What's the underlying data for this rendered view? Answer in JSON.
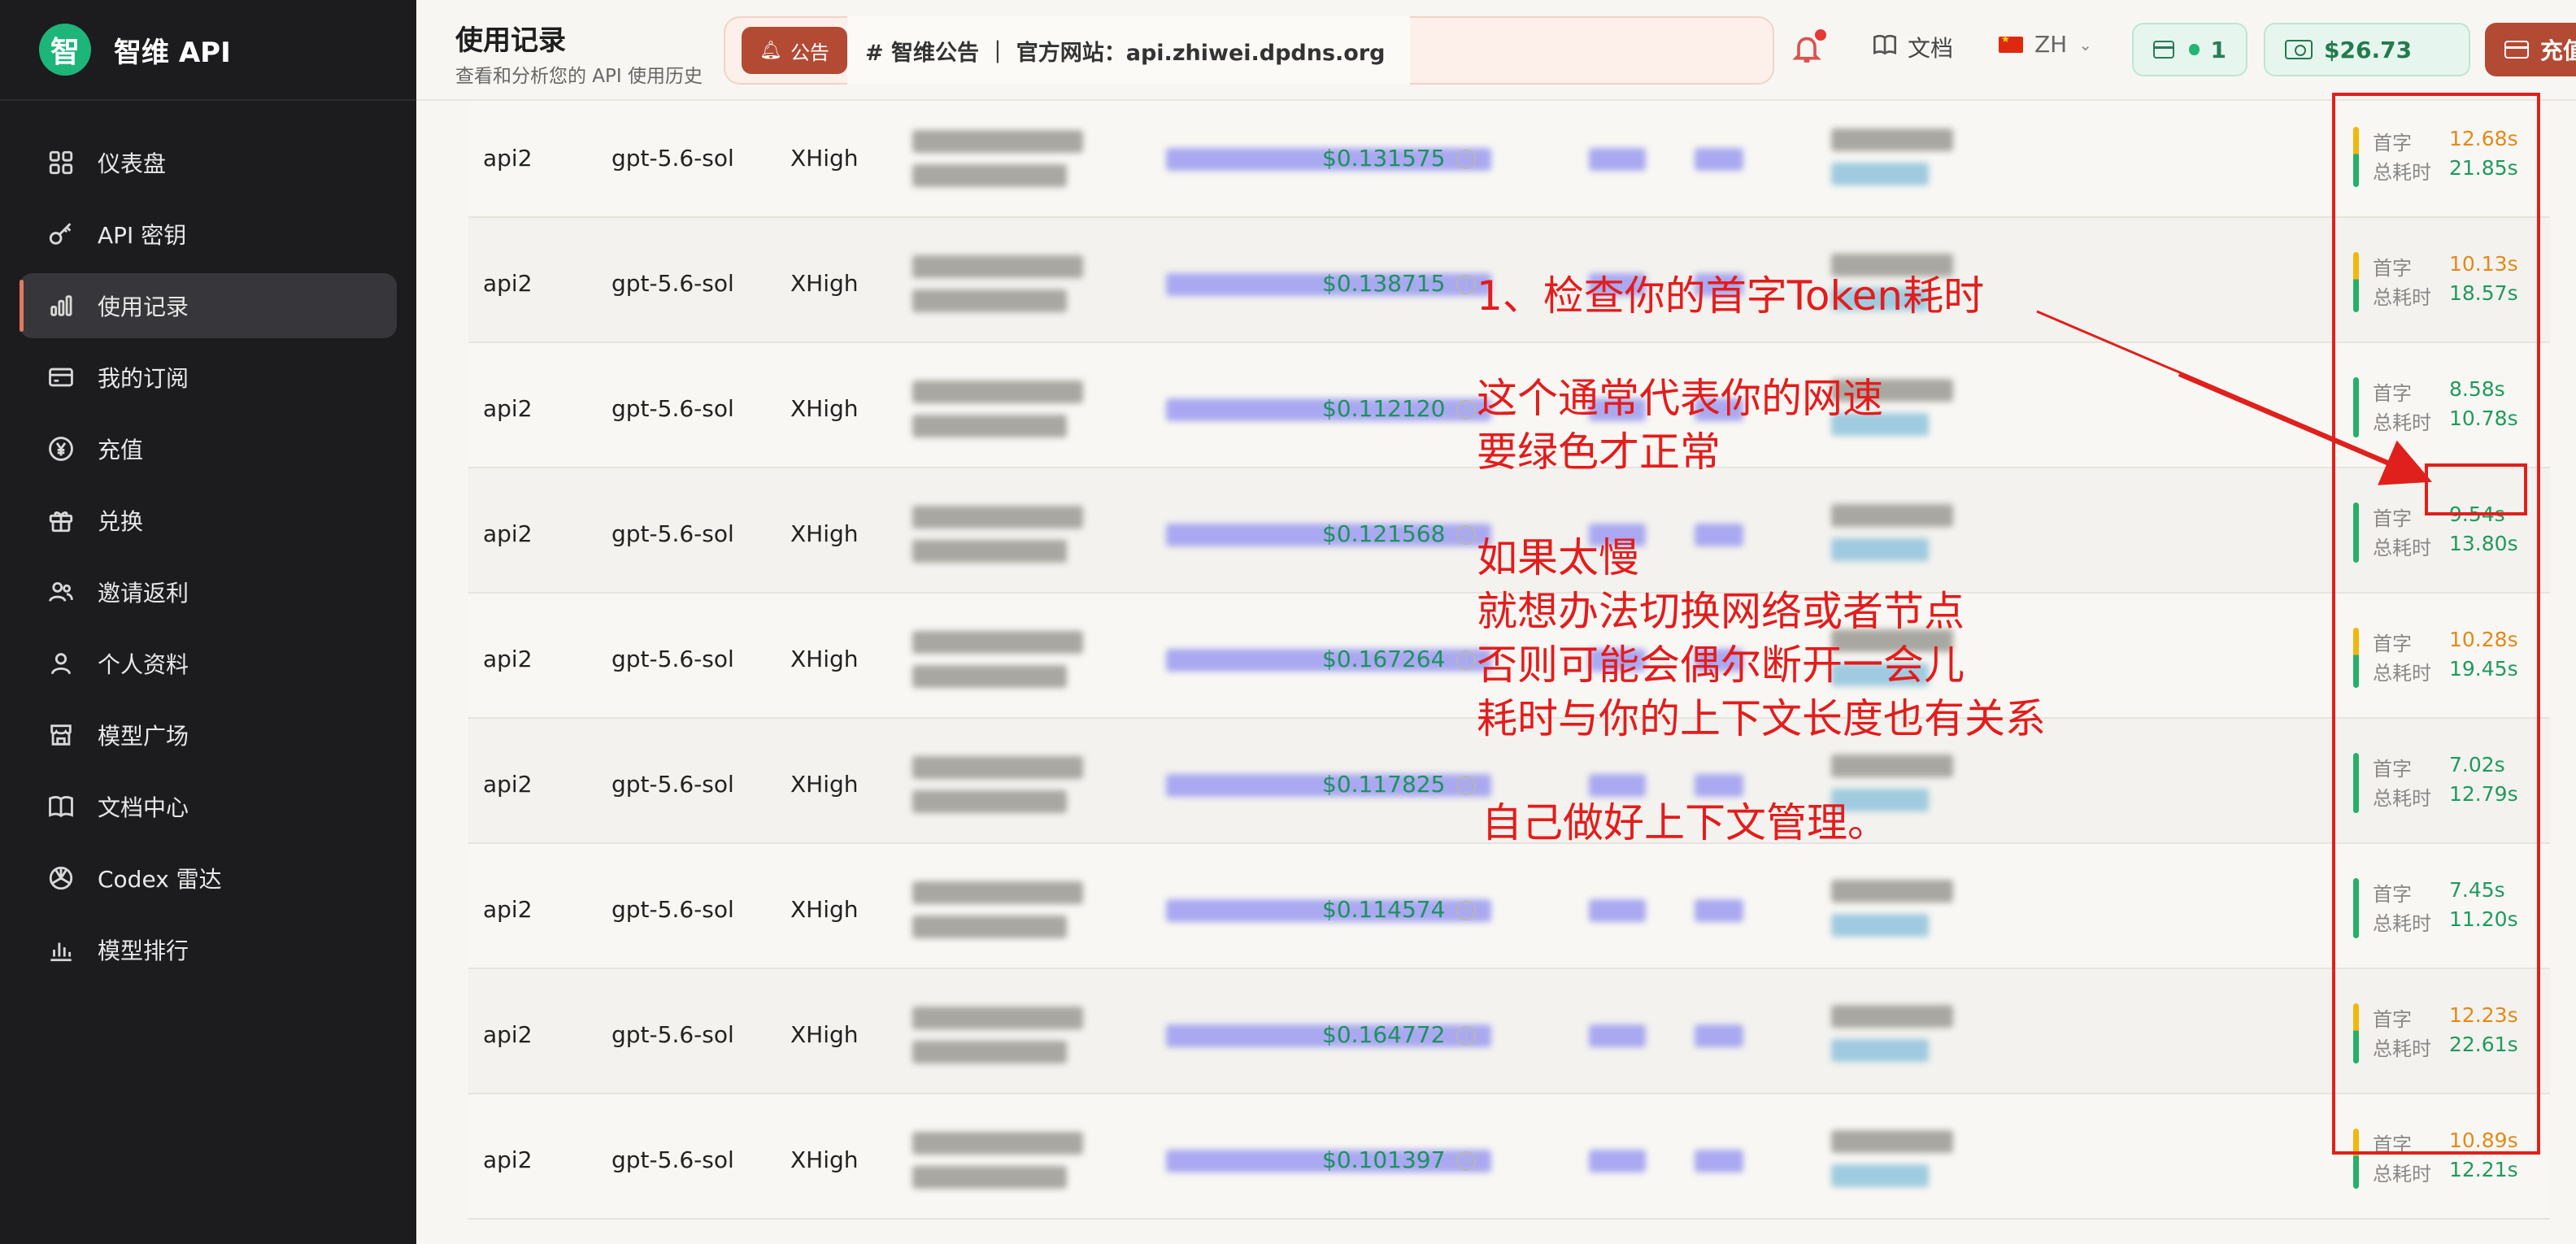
{
  "brand": {
    "logo_char": "智",
    "name": "智维 API"
  },
  "sidebar": {
    "items": [
      {
        "label": "仪表盘",
        "icon": "dashboard-icon",
        "active": false
      },
      {
        "label": "API 密钥",
        "icon": "key-icon",
        "active": false
      },
      {
        "label": "使用记录",
        "icon": "bar-chart-icon",
        "active": true
      },
      {
        "label": "我的订阅",
        "icon": "card-icon",
        "active": false
      },
      {
        "label": "充值",
        "icon": "yen-icon",
        "active": false
      },
      {
        "label": "兑换",
        "icon": "gift-icon",
        "active": false
      },
      {
        "label": "邀请返利",
        "icon": "users-icon",
        "active": false
      },
      {
        "label": "个人资料",
        "icon": "user-icon",
        "active": false
      },
      {
        "label": "模型广场",
        "icon": "store-icon",
        "active": false
      },
      {
        "label": "文档中心",
        "icon": "book-icon",
        "active": false
      },
      {
        "label": "Codex 雷达",
        "icon": "openai-icon",
        "active": false
      },
      {
        "label": "模型排行",
        "icon": "ranking-icon",
        "active": false
      }
    ]
  },
  "header": {
    "title": "使用记录",
    "subtitle": "查看和分析您的 API 使用历史",
    "notice_badge": "公告",
    "notice_text": "# 智维公告 ｜ 官方网站：api.zhiwei.dpdns.org",
    "docs_label": "文档",
    "lang_label": "ZH",
    "subscription_count": "1",
    "balance": "$26.73",
    "topup_label": "充值"
  },
  "table": {
    "first_token_label": "首字",
    "total_time_label": "总耗时",
    "rows": [
      {
        "api": "api2",
        "model": "gpt-5.6-sol",
        "level": "XHigh",
        "cost": "$0.131575",
        "first": "12.68s",
        "first_color": "orange",
        "total": "21.85s"
      },
      {
        "api": "api2",
        "model": "gpt-5.6-sol",
        "level": "XHigh",
        "cost": "$0.138715",
        "first": "10.13s",
        "first_color": "orange",
        "total": "18.57s"
      },
      {
        "api": "api2",
        "model": "gpt-5.6-sol",
        "level": "XHigh",
        "cost": "$0.112120",
        "first": "8.58s",
        "first_color": "green",
        "total": "10.78s"
      },
      {
        "api": "api2",
        "model": "gpt-5.6-sol",
        "level": "XHigh",
        "cost": "$0.121568",
        "first": "9.54s",
        "first_color": "green",
        "total": "13.80s"
      },
      {
        "api": "api2",
        "model": "gpt-5.6-sol",
        "level": "XHigh",
        "cost": "$0.167264",
        "first": "10.28s",
        "first_color": "orange",
        "total": "19.45s"
      },
      {
        "api": "api2",
        "model": "gpt-5.6-sol",
        "level": "XHigh",
        "cost": "$0.117825",
        "first": "7.02s",
        "first_color": "green",
        "total": "12.79s"
      },
      {
        "api": "api2",
        "model": "gpt-5.6-sol",
        "level": "XHigh",
        "cost": "$0.114574",
        "first": "7.45s",
        "first_color": "green",
        "total": "11.20s"
      },
      {
        "api": "api2",
        "model": "gpt-5.6-sol",
        "level": "XHigh",
        "cost": "$0.164772",
        "first": "12.23s",
        "first_color": "orange",
        "total": "22.61s"
      },
      {
        "api": "api2",
        "model": "gpt-5.6-sol",
        "level": "XHigh",
        "cost": "$0.101397",
        "first": "10.89s",
        "first_color": "orange",
        "total": "12.21s"
      }
    ]
  },
  "annotation": {
    "line1": "1、检查你的首字Token耗时",
    "line2": " 这个通常代表你的网速",
    "line3": "要绿色才正常",
    "line4": "如果太慢",
    "line5": "就想办法切换网络或者节点",
    "line6": "否则可能会偶尔断开一会儿",
    "line7": "耗时与你的上下文长度也有关系",
    "line8": "自己做好上下文管理。",
    "color": "#e31c1c"
  }
}
